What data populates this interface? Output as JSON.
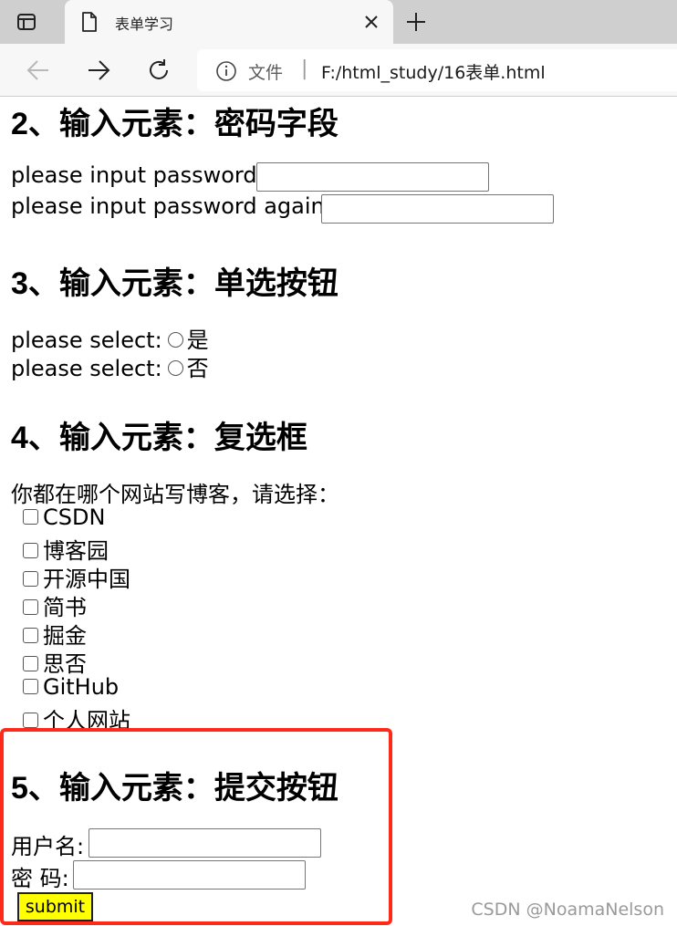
{
  "browser": {
    "tab_title": "表单学习",
    "site_label": "文件",
    "separator": "|",
    "url": "F:/html_study/16表单.html"
  },
  "sections": {
    "password": {
      "heading": "2、输入元素：密码字段",
      "label1": "please input password:",
      "label2": "please input password again:"
    },
    "radio": {
      "heading": "3、输入元素：单选按钮",
      "row1_label": "please select:",
      "row1_option": "是",
      "row2_label": "please select:",
      "row2_option": "否"
    },
    "checkbox": {
      "heading": "4、输入元素：复选框",
      "prompt": "你都在哪个网站写博客，请选择：",
      "options": [
        "CSDN",
        "博客园",
        "开源中国",
        "简书",
        "掘金",
        "思否",
        "GitHub",
        "个人网站"
      ]
    },
    "submit": {
      "heading": "5、输入元素：提交按钮",
      "username_label": "用户名:",
      "password_label": "密 码:",
      "submit_label": "submit"
    }
  },
  "watermark": "CSDN @NoamaNelson",
  "colors": {
    "highlight_border": "#ff2a1a",
    "submit_bg": "#ffff00"
  }
}
